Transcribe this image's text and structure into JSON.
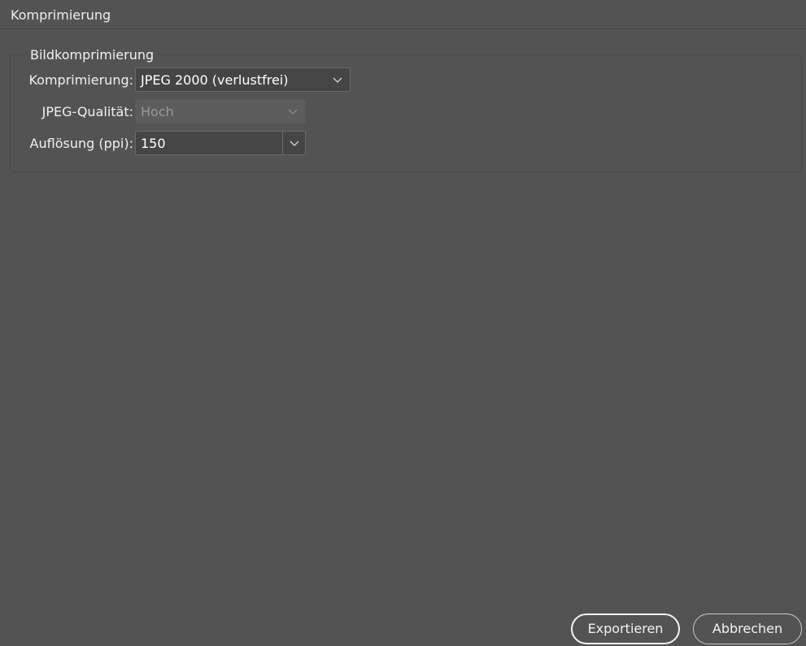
{
  "section": {
    "title": "Komprimierung"
  },
  "group": {
    "legend": "Bildkomprimierung",
    "compression": {
      "label": "Komprimierung:",
      "value": "JPEG 2000 (verlustfrei)"
    },
    "quality": {
      "label": "JPEG-Qualität:",
      "value": "Hoch",
      "enabled": false
    },
    "resolution": {
      "label": "Auflösung (ppi):",
      "value": "150"
    }
  },
  "buttons": {
    "export_label": "Exportieren",
    "cancel_label": "Abbrechen"
  },
  "icons": {
    "dropdown": "chevron-down-icon"
  },
  "colors": {
    "background": "#535353",
    "field": "#454545",
    "text": "#f0f0f0",
    "disabled_text": "#9a9a9a"
  }
}
